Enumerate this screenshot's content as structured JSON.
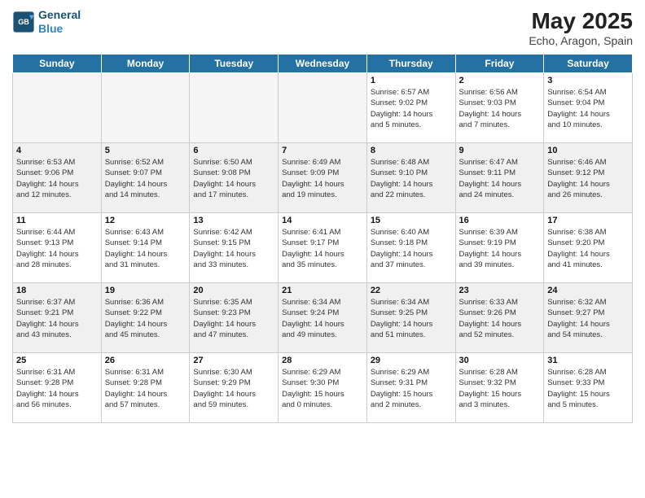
{
  "header": {
    "logo_line1": "General",
    "logo_line2": "Blue",
    "month_year": "May 2025",
    "location": "Echo, Aragon, Spain"
  },
  "weekdays": [
    "Sunday",
    "Monday",
    "Tuesday",
    "Wednesday",
    "Thursday",
    "Friday",
    "Saturday"
  ],
  "weeks": [
    [
      {
        "day": "",
        "info": "",
        "empty": true
      },
      {
        "day": "",
        "info": "",
        "empty": true
      },
      {
        "day": "",
        "info": "",
        "empty": true
      },
      {
        "day": "",
        "info": "",
        "empty": true
      },
      {
        "day": "1",
        "info": "Sunrise: 6:57 AM\nSunset: 9:02 PM\nDaylight: 14 hours\nand 5 minutes."
      },
      {
        "day": "2",
        "info": "Sunrise: 6:56 AM\nSunset: 9:03 PM\nDaylight: 14 hours\nand 7 minutes."
      },
      {
        "day": "3",
        "info": "Sunrise: 6:54 AM\nSunset: 9:04 PM\nDaylight: 14 hours\nand 10 minutes."
      }
    ],
    [
      {
        "day": "4",
        "info": "Sunrise: 6:53 AM\nSunset: 9:06 PM\nDaylight: 14 hours\nand 12 minutes.",
        "shaded": true
      },
      {
        "day": "5",
        "info": "Sunrise: 6:52 AM\nSunset: 9:07 PM\nDaylight: 14 hours\nand 14 minutes.",
        "shaded": true
      },
      {
        "day": "6",
        "info": "Sunrise: 6:50 AM\nSunset: 9:08 PM\nDaylight: 14 hours\nand 17 minutes.",
        "shaded": true
      },
      {
        "day": "7",
        "info": "Sunrise: 6:49 AM\nSunset: 9:09 PM\nDaylight: 14 hours\nand 19 minutes.",
        "shaded": true
      },
      {
        "day": "8",
        "info": "Sunrise: 6:48 AM\nSunset: 9:10 PM\nDaylight: 14 hours\nand 22 minutes.",
        "shaded": true
      },
      {
        "day": "9",
        "info": "Sunrise: 6:47 AM\nSunset: 9:11 PM\nDaylight: 14 hours\nand 24 minutes.",
        "shaded": true
      },
      {
        "day": "10",
        "info": "Sunrise: 6:46 AM\nSunset: 9:12 PM\nDaylight: 14 hours\nand 26 minutes.",
        "shaded": true
      }
    ],
    [
      {
        "day": "11",
        "info": "Sunrise: 6:44 AM\nSunset: 9:13 PM\nDaylight: 14 hours\nand 28 minutes."
      },
      {
        "day": "12",
        "info": "Sunrise: 6:43 AM\nSunset: 9:14 PM\nDaylight: 14 hours\nand 31 minutes."
      },
      {
        "day": "13",
        "info": "Sunrise: 6:42 AM\nSunset: 9:15 PM\nDaylight: 14 hours\nand 33 minutes."
      },
      {
        "day": "14",
        "info": "Sunrise: 6:41 AM\nSunset: 9:17 PM\nDaylight: 14 hours\nand 35 minutes."
      },
      {
        "day": "15",
        "info": "Sunrise: 6:40 AM\nSunset: 9:18 PM\nDaylight: 14 hours\nand 37 minutes."
      },
      {
        "day": "16",
        "info": "Sunrise: 6:39 AM\nSunset: 9:19 PM\nDaylight: 14 hours\nand 39 minutes."
      },
      {
        "day": "17",
        "info": "Sunrise: 6:38 AM\nSunset: 9:20 PM\nDaylight: 14 hours\nand 41 minutes."
      }
    ],
    [
      {
        "day": "18",
        "info": "Sunrise: 6:37 AM\nSunset: 9:21 PM\nDaylight: 14 hours\nand 43 minutes.",
        "shaded": true
      },
      {
        "day": "19",
        "info": "Sunrise: 6:36 AM\nSunset: 9:22 PM\nDaylight: 14 hours\nand 45 minutes.",
        "shaded": true
      },
      {
        "day": "20",
        "info": "Sunrise: 6:35 AM\nSunset: 9:23 PM\nDaylight: 14 hours\nand 47 minutes.",
        "shaded": true
      },
      {
        "day": "21",
        "info": "Sunrise: 6:34 AM\nSunset: 9:24 PM\nDaylight: 14 hours\nand 49 minutes.",
        "shaded": true
      },
      {
        "day": "22",
        "info": "Sunrise: 6:34 AM\nSunset: 9:25 PM\nDaylight: 14 hours\nand 51 minutes.",
        "shaded": true
      },
      {
        "day": "23",
        "info": "Sunrise: 6:33 AM\nSunset: 9:26 PM\nDaylight: 14 hours\nand 52 minutes.",
        "shaded": true
      },
      {
        "day": "24",
        "info": "Sunrise: 6:32 AM\nSunset: 9:27 PM\nDaylight: 14 hours\nand 54 minutes.",
        "shaded": true
      }
    ],
    [
      {
        "day": "25",
        "info": "Sunrise: 6:31 AM\nSunset: 9:28 PM\nDaylight: 14 hours\nand 56 minutes."
      },
      {
        "day": "26",
        "info": "Sunrise: 6:31 AM\nSunset: 9:28 PM\nDaylight: 14 hours\nand 57 minutes."
      },
      {
        "day": "27",
        "info": "Sunrise: 6:30 AM\nSunset: 9:29 PM\nDaylight: 14 hours\nand 59 minutes."
      },
      {
        "day": "28",
        "info": "Sunrise: 6:29 AM\nSunset: 9:30 PM\nDaylight: 15 hours\nand 0 minutes."
      },
      {
        "day": "29",
        "info": "Sunrise: 6:29 AM\nSunset: 9:31 PM\nDaylight: 15 hours\nand 2 minutes."
      },
      {
        "day": "30",
        "info": "Sunrise: 6:28 AM\nSunset: 9:32 PM\nDaylight: 15 hours\nand 3 minutes."
      },
      {
        "day": "31",
        "info": "Sunrise: 6:28 AM\nSunset: 9:33 PM\nDaylight: 15 hours\nand 5 minutes."
      }
    ]
  ]
}
